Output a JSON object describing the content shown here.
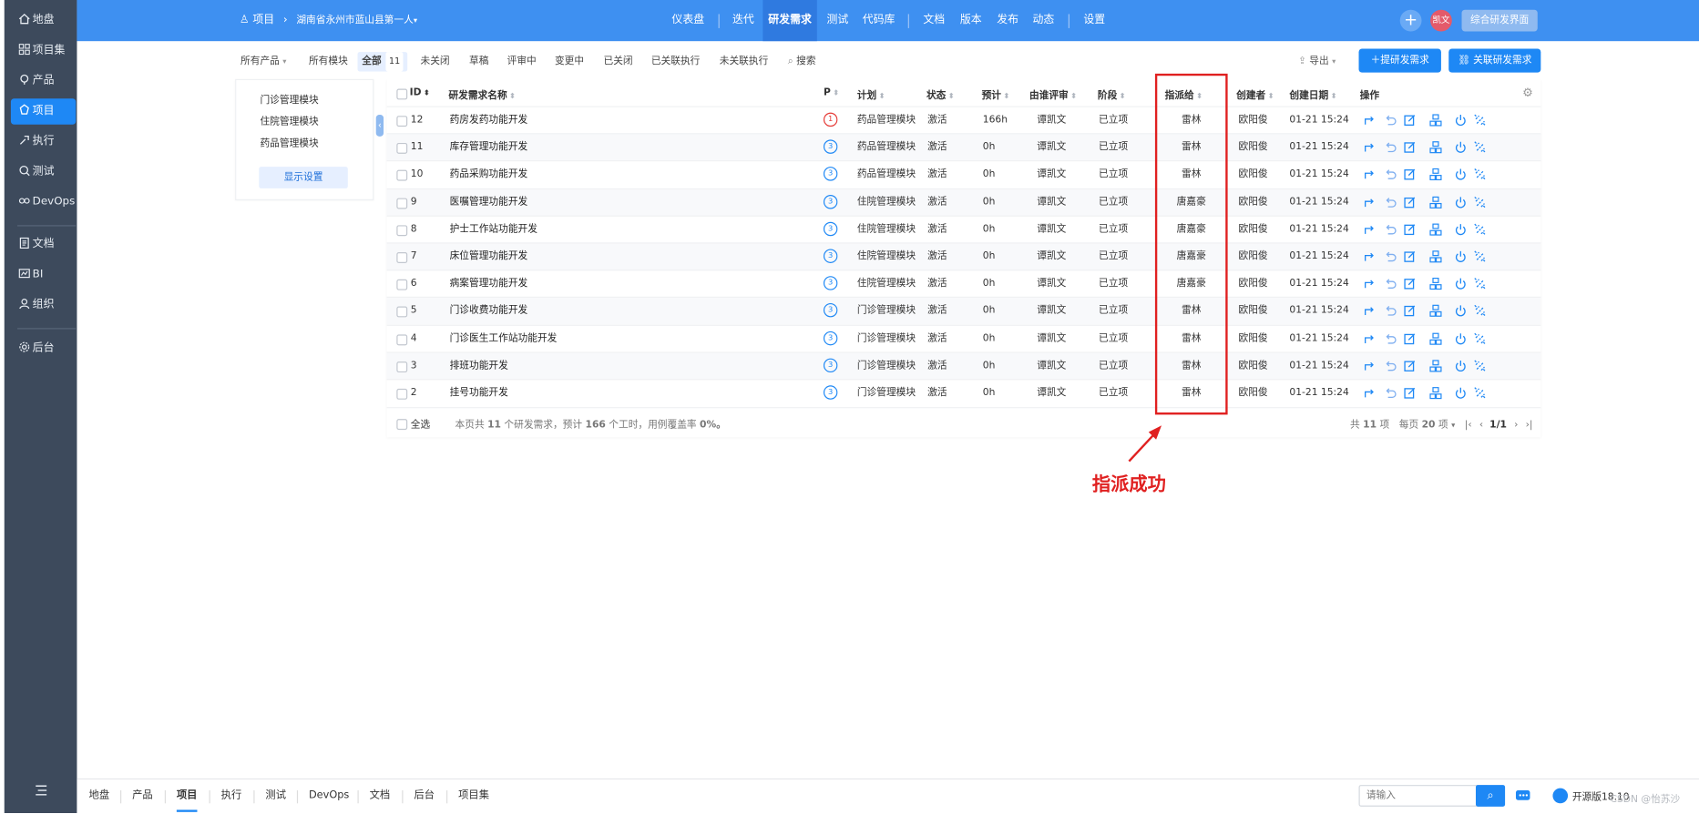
{
  "sidebar": {
    "items": [
      {
        "label": "地盘",
        "icon": "home-icon"
      },
      {
        "label": "项目集",
        "icon": "grid-icon"
      },
      {
        "label": "产品",
        "icon": "product-icon"
      },
      {
        "label": "项目",
        "icon": "project-icon",
        "active": true
      },
      {
        "label": "执行",
        "icon": "run-icon"
      },
      {
        "label": "测试",
        "icon": "test-icon"
      },
      {
        "label": "DevOps",
        "icon": "infinity-icon"
      },
      {
        "label": "文档",
        "icon": "doc-icon"
      },
      {
        "label": "BI",
        "icon": "bi-icon"
      },
      {
        "label": "组织",
        "icon": "org-icon"
      },
      {
        "label": "后台",
        "icon": "gear-icon"
      }
    ]
  },
  "topbar": {
    "crumb_root": "项目",
    "crumb_project": "湖南省永州市蓝山县第一人",
    "nav": [
      "仪表盘",
      "迭代",
      "研发需求",
      "测试",
      "代码库",
      "文档",
      "版本",
      "发布",
      "动态",
      "设置"
    ],
    "nav_active": "研发需求",
    "user_badge": "凯文",
    "switch_label": "综合研发界面"
  },
  "subnav": {
    "product_filter": "所有产品",
    "module_filter": "所有模块",
    "tabs": [
      {
        "label": "全部",
        "count": "11",
        "active": true
      },
      {
        "label": "未关闭"
      },
      {
        "label": "草稿"
      },
      {
        "label": "评审中"
      },
      {
        "label": "变更中"
      },
      {
        "label": "已关闭"
      },
      {
        "label": "已关联执行"
      },
      {
        "label": "未关联执行"
      }
    ],
    "search_label": "搜索",
    "export_label": "导出",
    "create_button": "提研发需求",
    "link_button": "关联研发需求"
  },
  "module_tree": {
    "items": [
      "门诊管理模块",
      "住院管理模块",
      "药品管理模块"
    ],
    "display_settings": "显示设置"
  },
  "table": {
    "columns": [
      "ID",
      "研发需求名称",
      "P",
      "计划",
      "状态",
      "预计",
      "由谁评审",
      "阶段",
      "指派给",
      "创建者",
      "创建日期",
      "操作"
    ],
    "rows": [
      {
        "id": "12",
        "name": "药房发药功能开发",
        "pri": "1",
        "plan": "药品管理模块",
        "status": "激活",
        "estimate": "166h",
        "reviewer": "谭凯文",
        "stage": "已立项",
        "assigned": "雷林",
        "creator": "欧阳俊",
        "date": "01-21 15:24"
      },
      {
        "id": "11",
        "name": "库存管理功能开发",
        "pri": "3",
        "plan": "药品管理模块",
        "status": "激活",
        "estimate": "0h",
        "reviewer": "谭凯文",
        "stage": "已立项",
        "assigned": "雷林",
        "creator": "欧阳俊",
        "date": "01-21 15:24"
      },
      {
        "id": "10",
        "name": "药品采购功能开发",
        "pri": "3",
        "plan": "药品管理模块",
        "status": "激活",
        "estimate": "0h",
        "reviewer": "谭凯文",
        "stage": "已立项",
        "assigned": "雷林",
        "creator": "欧阳俊",
        "date": "01-21 15:24"
      },
      {
        "id": "9",
        "name": "医嘱管理功能开发",
        "pri": "3",
        "plan": "住院管理模块",
        "status": "激活",
        "estimate": "0h",
        "reviewer": "谭凯文",
        "stage": "已立项",
        "assigned": "唐嘉豪",
        "creator": "欧阳俊",
        "date": "01-21 15:24"
      },
      {
        "id": "8",
        "name": "护士工作站功能开发",
        "pri": "3",
        "plan": "住院管理模块",
        "status": "激活",
        "estimate": "0h",
        "reviewer": "谭凯文",
        "stage": "已立项",
        "assigned": "唐嘉豪",
        "creator": "欧阳俊",
        "date": "01-21 15:24"
      },
      {
        "id": "7",
        "name": "床位管理功能开发",
        "pri": "3",
        "plan": "住院管理模块",
        "status": "激活",
        "estimate": "0h",
        "reviewer": "谭凯文",
        "stage": "已立项",
        "assigned": "唐嘉豪",
        "creator": "欧阳俊",
        "date": "01-21 15:24"
      },
      {
        "id": "6",
        "name": "病案管理功能开发",
        "pri": "3",
        "plan": "住院管理模块",
        "status": "激活",
        "estimate": "0h",
        "reviewer": "谭凯文",
        "stage": "已立项",
        "assigned": "唐嘉豪",
        "creator": "欧阳俊",
        "date": "01-21 15:24"
      },
      {
        "id": "5",
        "name": "门诊收费功能开发",
        "pri": "3",
        "plan": "门诊管理模块",
        "status": "激活",
        "estimate": "0h",
        "reviewer": "谭凯文",
        "stage": "已立项",
        "assigned": "雷林",
        "creator": "欧阳俊",
        "date": "01-21 15:24"
      },
      {
        "id": "4",
        "name": "门诊医生工作站功能开发",
        "pri": "3",
        "plan": "门诊管理模块",
        "status": "激活",
        "estimate": "0h",
        "reviewer": "谭凯文",
        "stage": "已立项",
        "assigned": "雷林",
        "creator": "欧阳俊",
        "date": "01-21 15:24"
      },
      {
        "id": "3",
        "name": "排班功能开发",
        "pri": "3",
        "plan": "门诊管理模块",
        "status": "激活",
        "estimate": "0h",
        "reviewer": "谭凯文",
        "stage": "已立项",
        "assigned": "雷林",
        "creator": "欧阳俊",
        "date": "01-21 15:24"
      },
      {
        "id": "2",
        "name": "挂号功能开发",
        "pri": "3",
        "plan": "门诊管理模块",
        "status": "激活",
        "estimate": "0h",
        "reviewer": "谭凯文",
        "stage": "已立项",
        "assigned": "雷林",
        "creator": "欧阳俊",
        "date": "01-21 15:24"
      }
    ],
    "footer": {
      "select_all": "全选",
      "summary_pre": "本页共",
      "summary_count": "11",
      "summary_mid": "个研发需求，预计",
      "summary_hours": "166",
      "summary_post": "个工时，用例覆盖率",
      "summary_rate": "0%。",
      "total_pre": "共",
      "total_count": "11",
      "total_post": "项",
      "per_page_pre": "每页",
      "per_page": "20",
      "per_page_post": "项",
      "page": "1/1"
    }
  },
  "annotation": {
    "text": "指派成功",
    "color": "#e02020"
  },
  "bottombar": {
    "nav": [
      "地盘",
      "产品",
      "项目",
      "执行",
      "测试",
      "DevOps",
      "文档",
      "后台",
      "项目集"
    ],
    "active": "项目",
    "search_placeholder": "请输入",
    "version": "开源版18.10",
    "watermark": "CSDN @怡苏沙"
  }
}
